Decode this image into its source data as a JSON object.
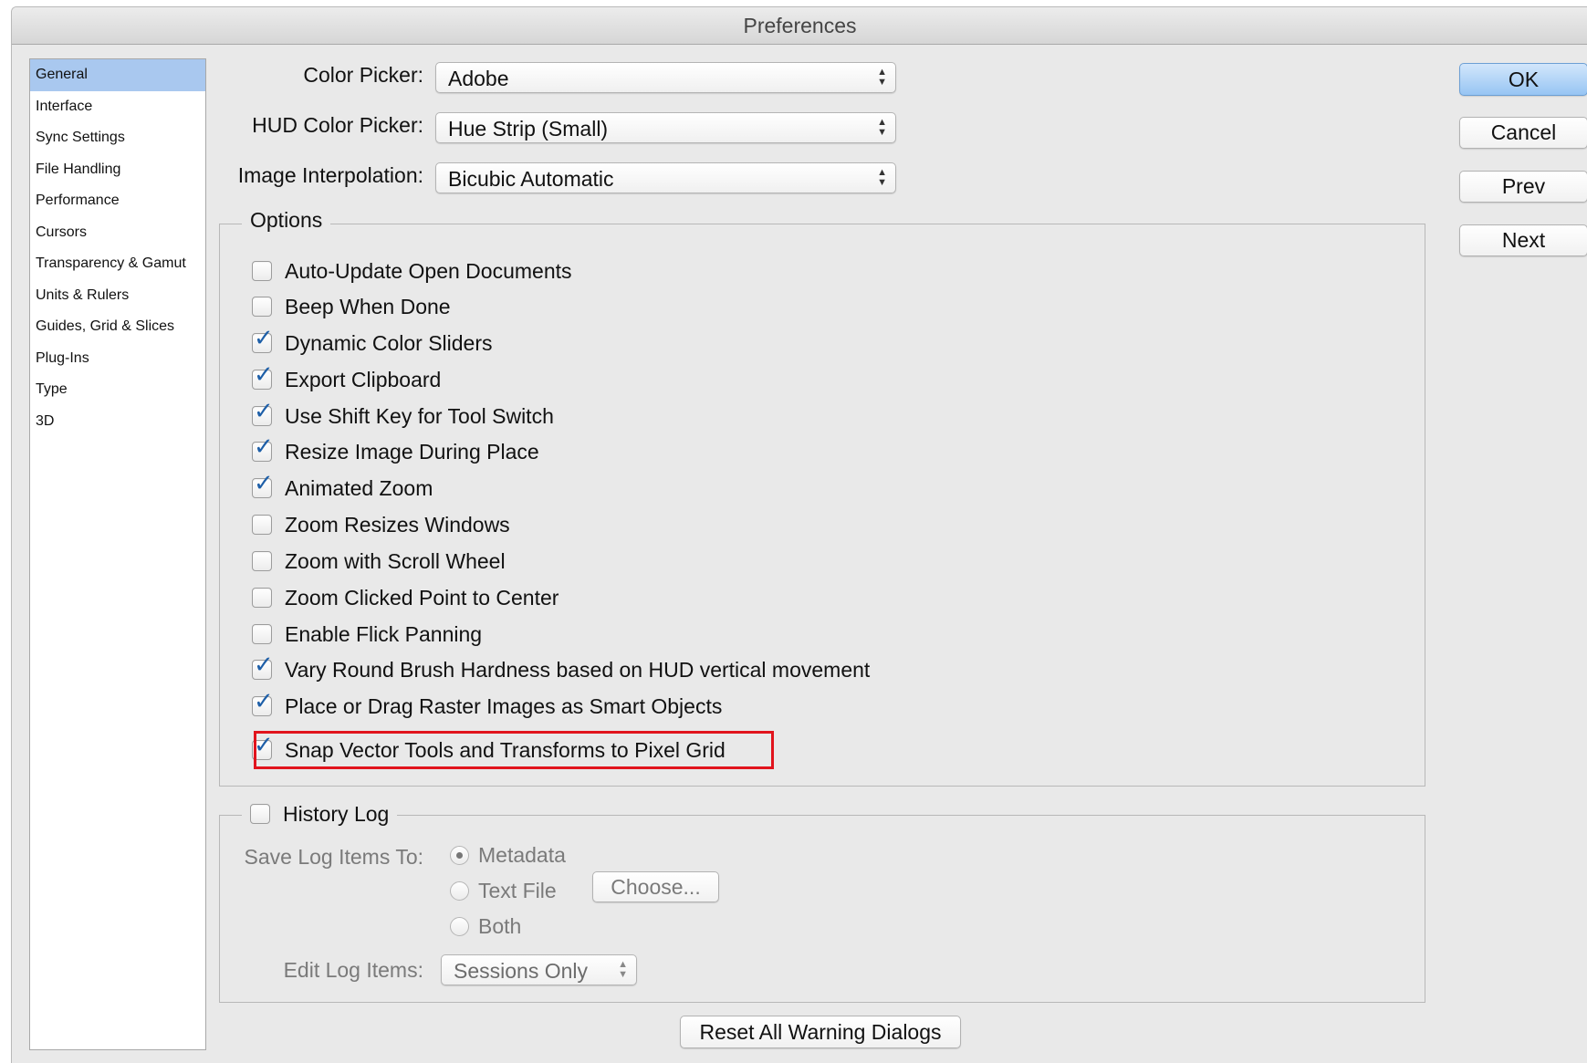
{
  "window": {
    "title": "Preferences"
  },
  "sidebar": {
    "items": [
      {
        "label": "General",
        "selected": true
      },
      {
        "label": "Interface"
      },
      {
        "label": "Sync Settings"
      },
      {
        "label": "File Handling"
      },
      {
        "label": "Performance"
      },
      {
        "label": "Cursors"
      },
      {
        "label": "Transparency & Gamut"
      },
      {
        "label": "Units & Rulers"
      },
      {
        "label": "Guides, Grid & Slices"
      },
      {
        "label": "Plug-Ins"
      },
      {
        "label": "Type"
      },
      {
        "label": "3D"
      }
    ]
  },
  "general": {
    "color_picker": {
      "label": "Color Picker:",
      "value": "Adobe"
    },
    "hud_color_picker": {
      "label": "HUD Color Picker:",
      "value": "Hue Strip (Small)"
    },
    "image_interpolation": {
      "label": "Image Interpolation:",
      "value": "Bicubic Automatic"
    }
  },
  "options": {
    "legend": "Options",
    "items": [
      {
        "label": "Auto-Update Open Documents",
        "checked": false
      },
      {
        "label": "Beep When Done",
        "checked": false
      },
      {
        "label": "Dynamic Color Sliders",
        "checked": true
      },
      {
        "label": "Export Clipboard",
        "checked": true
      },
      {
        "label": "Use Shift Key for Tool Switch",
        "checked": true
      },
      {
        "label": "Resize Image During Place",
        "checked": true
      },
      {
        "label": "Animated Zoom",
        "checked": true
      },
      {
        "label": "Zoom Resizes Windows",
        "checked": false
      },
      {
        "label": "Zoom with Scroll Wheel",
        "checked": false
      },
      {
        "label": "Zoom Clicked Point to Center",
        "checked": false
      },
      {
        "label": "Enable Flick Panning",
        "checked": false
      },
      {
        "label": "Vary Round Brush Hardness based on HUD vertical movement",
        "checked": true
      },
      {
        "label": "Place or Drag Raster Images as Smart Objects",
        "checked": true
      },
      {
        "label": "Snap Vector Tools and Transforms to Pixel Grid",
        "checked": true,
        "highlighted": true
      }
    ]
  },
  "history_log": {
    "legend": "History Log",
    "checked": false,
    "save_label": "Save Log Items To:",
    "radios": [
      {
        "label": "Metadata",
        "selected": true
      },
      {
        "label": "Text File",
        "selected": false
      },
      {
        "label": "Both",
        "selected": false
      }
    ],
    "choose_button": "Choose...",
    "edit_label": "Edit Log Items:",
    "edit_value": "Sessions Only"
  },
  "reset_button": "Reset All Warning Dialogs",
  "buttons": {
    "ok": "OK",
    "cancel": "Cancel",
    "prev": "Prev",
    "next": "Next"
  },
  "colors": {
    "selection": "#a9c8ef",
    "check": "#1e5fa8",
    "highlight_border": "#e1141d",
    "default_button": "#97c5f3"
  }
}
